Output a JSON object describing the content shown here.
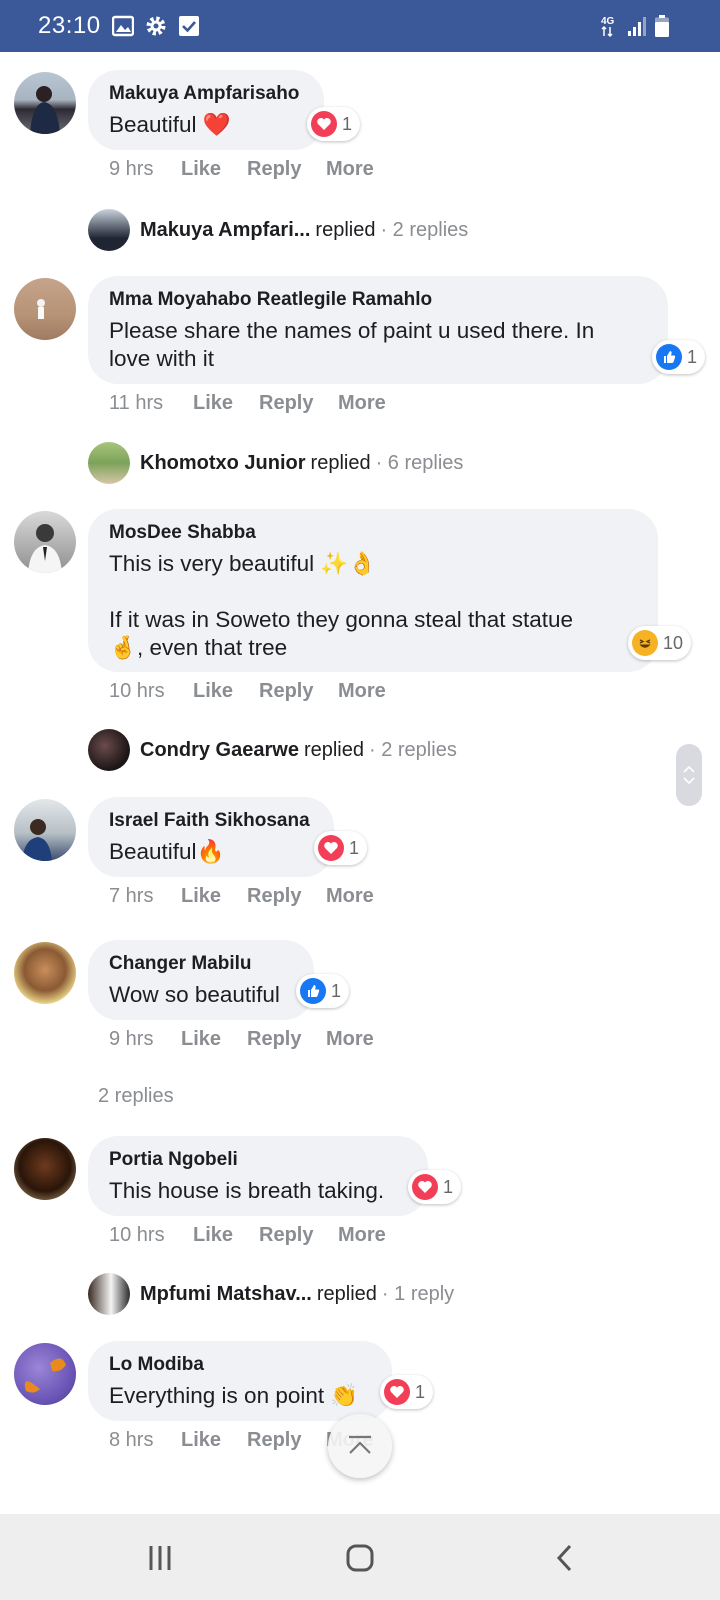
{
  "status_bar": {
    "time": "23:10",
    "left_icons": [
      "image-icon",
      "gear-icon",
      "checkbox-icon"
    ],
    "network": "4G",
    "color": "#3b5998"
  },
  "comments": [
    {
      "name": "Makuya Ampfarisaho",
      "text": "Beautiful ❤️",
      "reaction": "love",
      "reaction_count": "1",
      "time": "9 hrs"
    },
    {
      "name": "Mma Moyahabo Reatlegile Ramahlo",
      "text": "Please share the names of paint u used there. In\nlove with it",
      "reaction": "like",
      "reaction_count": "1",
      "time": "11 hrs"
    },
    {
      "name": "MosDee Shabba",
      "text": "This is very beautiful ✨👌\n\nIf it was in Soweto they gonna steal that statue\n🤞, even that tree",
      "reaction": "haha",
      "reaction_count": "10",
      "time": "10 hrs"
    },
    {
      "name": "Israel Faith Sikhosana",
      "text": "Beautiful🔥",
      "reaction": "love",
      "reaction_count": "1",
      "time": "7 hrs"
    },
    {
      "name": "Changer Mabilu",
      "text": "Wow so beautiful",
      "reaction": "like",
      "reaction_count": "1",
      "time": "9 hrs"
    },
    {
      "name": "Portia Ngobeli",
      "text": "This house is breath taking.",
      "reaction": "love",
      "reaction_count": "1",
      "time": "10 hrs"
    },
    {
      "name": "Lo Modiba",
      "text": "Everything is on point 👏",
      "reaction": "love",
      "reaction_count": "1",
      "time": "8 hrs"
    }
  ],
  "actions": {
    "like": "Like",
    "reply": "Reply",
    "more": "More"
  },
  "replied_rows": [
    {
      "name": "Makuya Ampfari...",
      "verb": "replied",
      "count": "· 2 replies"
    },
    {
      "name": "Khomotxo Junior",
      "verb": "replied",
      "count": "· 6 replies"
    },
    {
      "name": "Condry Gaearwe",
      "verb": "replied",
      "count": "· 2 replies"
    },
    {
      "name": "Mpfumi Matshav...",
      "verb": "replied",
      "count": "· 1 reply"
    }
  ],
  "plain_replies": "2 replies",
  "colors": {
    "like_blue": "#1877f2",
    "love_red": "#f33e58",
    "haha_yellow": "#f7b125",
    "bubble_bg": "#f0f2f5",
    "meta_gray": "#8a8d91"
  }
}
